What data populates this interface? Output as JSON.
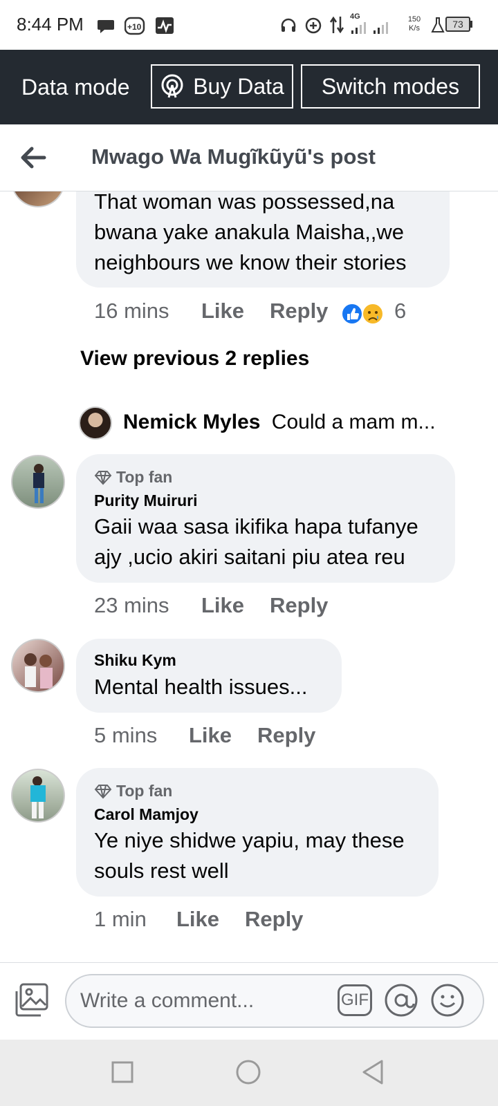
{
  "status_bar": {
    "time": "8:44 PM",
    "network": "4G",
    "speed_value": "150",
    "speed_unit": "K/s",
    "battery": "73",
    "icons": [
      "chat-bubble-icon",
      "plus10-icon",
      "activity-icon",
      "headset-icon",
      "data-saver-icon",
      "data-transfer-icon",
      "signal-icon",
      "signal-icon-2",
      "flask-icon",
      "battery-icon"
    ]
  },
  "data_mode_bar": {
    "label": "Data mode",
    "buy_data": "Buy Data",
    "switch_modes": "Switch modes"
  },
  "header": {
    "title": "Mwago Wa Mugĩkũyũ's post"
  },
  "thread": {
    "first": {
      "text_line1": "That woman was possessed,na",
      "text_line2": "bwana yake anakula Maisha,,we",
      "text_line3": "neighbours we know their stories",
      "time": "16 mins",
      "like": "Like",
      "reply": "Reply",
      "reaction_count": "6"
    },
    "view_previous": "View previous 2 replies",
    "latest_reply": {
      "name": "Nemick Myles",
      "preview": "Could a mam m..."
    }
  },
  "comments": [
    {
      "badge": "Top fan",
      "name": "Purity Muiruri",
      "line1": "Gaii waa sasa ikifika hapa tufanye",
      "line2": "ajy ,ucio akiri saitani piu atea reu",
      "time": "23 mins",
      "like": "Like",
      "reply": "Reply"
    },
    {
      "name": "Shiku Kym",
      "line1": "Mental health issues...",
      "time": "5 mins",
      "like": "Like",
      "reply": "Reply"
    },
    {
      "badge": "Top fan",
      "name": "Carol Mamjoy",
      "line1": "Ye niye shidwe yapiu, may these",
      "line2": "souls rest well",
      "time": "1 min",
      "like": "Like",
      "reply": "Reply"
    }
  ],
  "composer": {
    "placeholder": "Write a comment...",
    "gif": "GIF"
  },
  "colors": {
    "data_bar": "#242a31",
    "bubble": "#f0f2f5",
    "meta_text": "#65676b",
    "like_blue": "#1877f2",
    "sad_yellow": "#f7b928"
  }
}
